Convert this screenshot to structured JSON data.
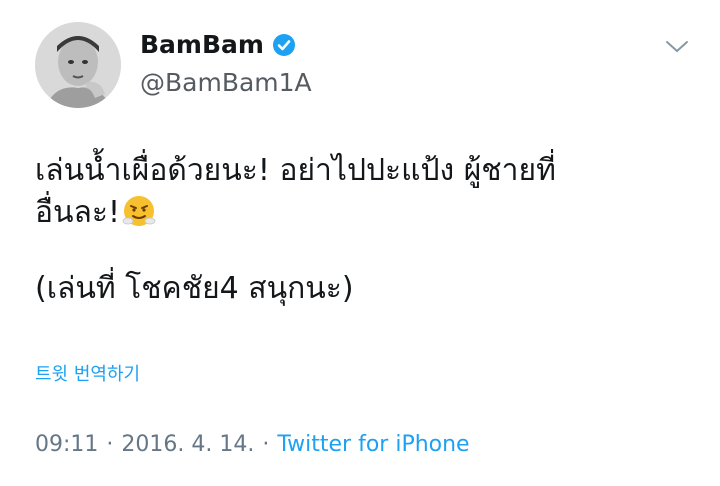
{
  "user": {
    "display_name": "BamBam",
    "handle": "@BamBam1A",
    "verified": true
  },
  "tweet": {
    "line1": "เล่นน้ำเผื่อด้วยนะ! อย่าไปปะแป้ง ผู้ชายที่",
    "line2": "อื่นละ!",
    "line2_emoji": "face-with-steam-icon",
    "paragraph2": "(เล่นที่ โชคชัย4 สนุกนะ)"
  },
  "translate_label": "트윗 번역하기",
  "meta": {
    "time": "09:11",
    "sep1": "·",
    "date": "2016. 4. 14.",
    "sep2": "·",
    "source": "Twitter for iPhone"
  },
  "colors": {
    "link": "#1da1f2",
    "meta": "#657786",
    "text": "#14171a",
    "verified": "#1da1f2"
  },
  "icons": {
    "verified": "verified-badge-icon",
    "menu": "chevron-down-icon"
  }
}
